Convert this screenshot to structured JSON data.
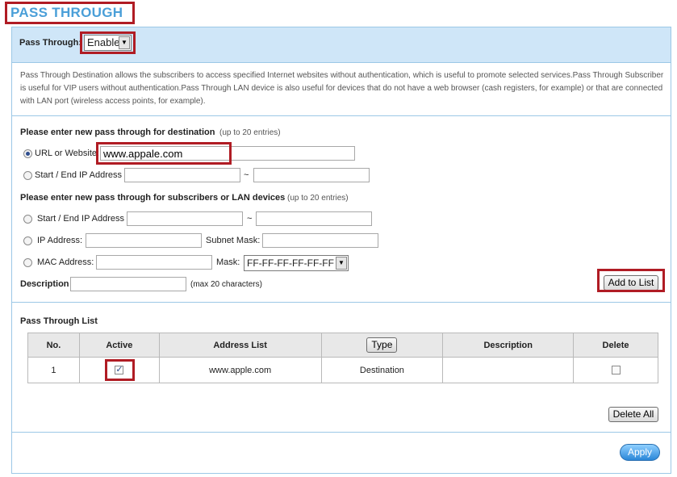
{
  "page": {
    "title": "PASS THROUGH"
  },
  "toolbar": {
    "label": "Pass Through:",
    "value": "Enable"
  },
  "description": "Pass Through Destination allows the subscribers to access specified Internet websites without authentication, which is useful to promote selected services.Pass Through Subscriber is useful for VIP users without authentication.Pass Through LAN device is also useful for devices that do not have a web browser (cash registers, for example) or that are connected with LAN port (wireless access points, for example).",
  "destination": {
    "heading": "Please enter new pass through for destination",
    "limit": "(up to 20 entries)",
    "url_label": "URL or Website:",
    "url_value": "www.appale.com",
    "ip_label": "Start / End IP Address",
    "separator": "~"
  },
  "subscribers": {
    "heading": "Please enter new pass through for subscribers or LAN devices",
    "limit": "(up to 20 entries)",
    "ip_range_label": "Start / End IP Address",
    "separator": "~",
    "ip_label": "IP Address:",
    "subnet_label": "Subnet Mask:",
    "mac_label": "MAC Address:",
    "mask_label": "Mask:",
    "mask_value": "FF-FF-FF-FF-FF-FF"
  },
  "description_field": {
    "label": "Description",
    "hint": "(max 20 characters)"
  },
  "buttons": {
    "add": "Add to List",
    "delete_all": "Delete All",
    "apply": "Apply",
    "type": "Type"
  },
  "list": {
    "heading": "Pass Through List",
    "columns": [
      "No.",
      "Active",
      "Address List",
      "Type",
      "Description",
      "Delete"
    ],
    "rows": [
      {
        "no": "1",
        "active": true,
        "address": "www.apple.com",
        "type": "Destination",
        "description": "",
        "delete": false
      }
    ]
  },
  "colors": {
    "title": "#4a9fd8",
    "band": "#cfe6f8",
    "highlight": "#b01c24",
    "apply": "#2a86d8"
  }
}
